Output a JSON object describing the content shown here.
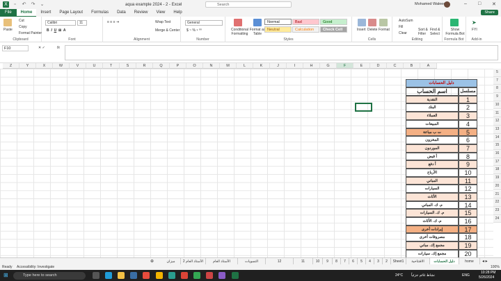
{
  "app": {
    "title": "aqua example 2024 - 2  -  Excel",
    "search_placeholder": "Search",
    "user": "Mohamed Waleed"
  },
  "tabs": [
    "File",
    "Home",
    "Insert",
    "Page Layout",
    "Formulas",
    "Data",
    "Review",
    "View",
    "Help"
  ],
  "share_label": "Share",
  "ribbon": {
    "clipboard": {
      "paste": "Paste",
      "cut": "Cut",
      "copy": "Copy",
      "format_painter": "Format Painter",
      "label": "Clipboard"
    },
    "font": {
      "name": "Calibri",
      "size": "11",
      "label": "Font"
    },
    "alignment": {
      "wrap": "Wrap Text",
      "merge": "Merge & Center",
      "label": "Alignment"
    },
    "number": {
      "format": "General",
      "label": "Number"
    },
    "styles": {
      "cond": "Conditional Formatting",
      "table": "Format as Table",
      "normal": "Normal",
      "bad": "Bad",
      "good": "Good",
      "neutral": "Neutral",
      "calculation": "Calculation",
      "check_cell": "Check Cell",
      "label": "Styles"
    },
    "cells": {
      "insert": "Insert",
      "delete": "Delete",
      "format": "Format",
      "label": "Cells"
    },
    "editing": {
      "autosum": "AutoSum",
      "fill": "Fill",
      "clear": "Clear",
      "sort": "Sort & Filter",
      "find": "Find & Select",
      "label": "Editing"
    },
    "formula_bot": {
      "show": "Show Formula Bot",
      "label": "Formula Bot"
    },
    "addin": {
      "fyi": "FYI",
      "label": "Add-in"
    }
  },
  "formula_bar": {
    "name_box": "F10",
    "fx": "fx"
  },
  "columns": [
    "Z",
    "Y",
    "X",
    "W",
    "V",
    "U",
    "T",
    "S",
    "R",
    "Q",
    "P",
    "O",
    "N",
    "M",
    "L",
    "K",
    "J",
    "I",
    "H",
    "G",
    "F",
    "E",
    "D",
    "C",
    "B",
    "A"
  ],
  "rows": [
    "5",
    "7",
    "8",
    "9",
    "10",
    "11",
    "12",
    "13",
    "14",
    "15",
    "16",
    "17",
    "18",
    "19",
    "20",
    "21",
    "22",
    "23",
    "24"
  ],
  "table": {
    "title": "دليل الحسابات",
    "header_name": "اسم الحساب",
    "header_num": "مسلسل",
    "rows": [
      {
        "name": "النقدية",
        "num": "1",
        "bg": "#fce4d6"
      },
      {
        "name": "البنك",
        "num": "2",
        "bg": "#ffffff"
      },
      {
        "name": "العملاء",
        "num": "3",
        "bg": "#fce4d6"
      },
      {
        "name": "المبيعات",
        "num": "4",
        "bg": "#ffffff"
      },
      {
        "name": "ت ب مباعة",
        "num": "5",
        "bg": "#f4b084"
      },
      {
        "name": "المخزون",
        "num": "6",
        "bg": "#ffffff"
      },
      {
        "name": "الموردون",
        "num": "7",
        "bg": "#fce4d6"
      },
      {
        "name": "أ قبض",
        "num": "8",
        "bg": "#ffffff"
      },
      {
        "name": "أ دفع",
        "num": "9",
        "bg": "#fce4d6"
      },
      {
        "name": "الأرباح",
        "num": "10",
        "bg": "#ffffff"
      },
      {
        "name": "المباني",
        "num": "11",
        "bg": "#fce4d6"
      },
      {
        "name": "السيارات",
        "num": "12",
        "bg": "#ffffff"
      },
      {
        "name": "الأثاث",
        "num": "13",
        "bg": "#fce4d6"
      },
      {
        "name": "م. ك. المباني",
        "num": "14",
        "bg": "#ffffff"
      },
      {
        "name": "م. ك. السيارات",
        "num": "15",
        "bg": "#fce4d6"
      },
      {
        "name": "م. ك. الأثاث",
        "num": "16",
        "bg": "#ffffff"
      },
      {
        "name": "إيرادات أخرى",
        "num": "17",
        "bg": "#f4b084"
      },
      {
        "name": "مصروفات أخرى",
        "num": "18",
        "bg": "#ffffff"
      },
      {
        "name": "مجمع إك. مباني",
        "num": "19",
        "bg": "#fce4d6"
      },
      {
        "name": "مجمع إك. سيارات",
        "num": "20",
        "bg": "#ffffff"
      }
    ]
  },
  "sheets": [
    "home",
    "دليل الحسابات",
    "الافتتاحية",
    "Sheet1",
    "2",
    "3",
    "4",
    "5",
    "6",
    "7",
    "8",
    "9",
    "10",
    "11",
    "12",
    "التسويات",
    "الأستاذ العام",
    "الأستاذ العام 2",
    "ميزان المراجعة",
    "ق الدخل",
    "الميزانية"
  ],
  "status": {
    "ready": "Ready",
    "accessibility": "Accessibility: Investigate",
    "zoom": "100%"
  },
  "taskbar": {
    "search": "Type here to search",
    "weather": "24°C",
    "weather_label": "نشاط غائم جزئياً",
    "lang": "ENG",
    "time": "10:28 PM",
    "date": "5/26/2024"
  }
}
